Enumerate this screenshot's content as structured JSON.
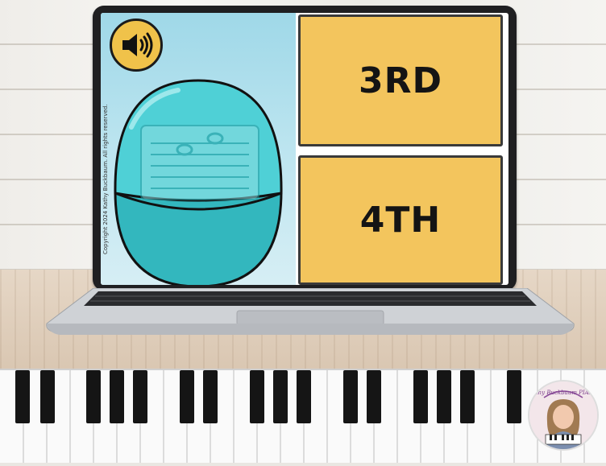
{
  "scene": {
    "wall_color": "#f2f1ed",
    "floor_color": "#ddcab6"
  },
  "screen": {
    "sound_button": {
      "icon": "speaker-volume-icon",
      "color": "#f0c24a"
    },
    "copyright": "Copyright 2024 Kathy Buckbaum. All rights reserved.",
    "egg": {
      "color": "#3fc2c8",
      "contents": "music staff card"
    },
    "answers": [
      {
        "label": "3RD"
      },
      {
        "label": "4TH"
      }
    ],
    "answer_color": "#f3c55d"
  },
  "branding": {
    "logo_text": "Kathy Buckbaum PIANO"
  }
}
